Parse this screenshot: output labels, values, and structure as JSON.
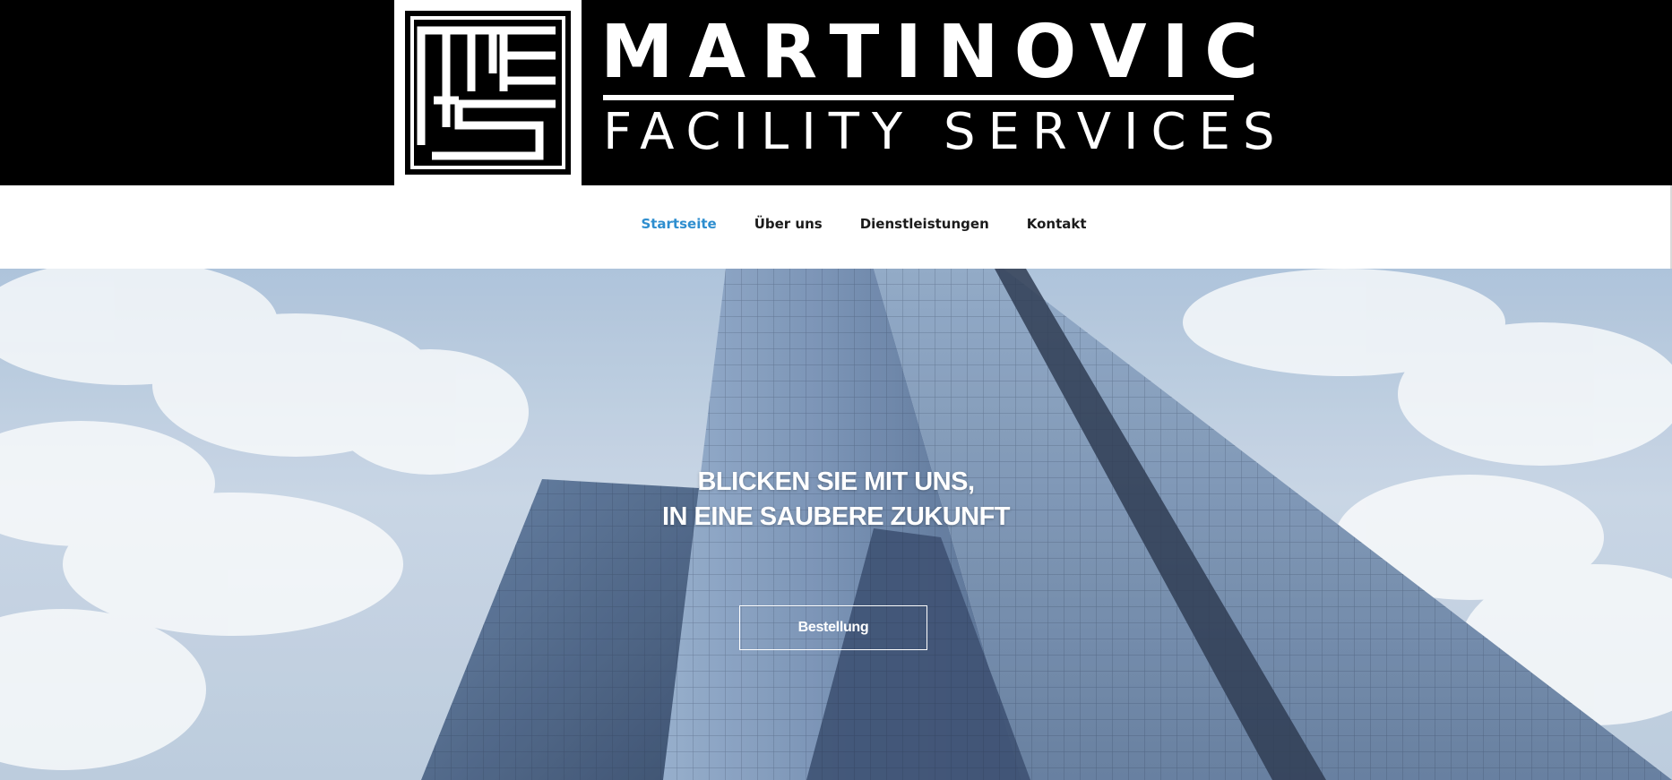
{
  "brand": {
    "name": "MARTINOVIC",
    "tagline": "FACILITY SERVICES",
    "monogram": "MFS",
    "colors": {
      "header_bg": "#000000",
      "logo_fg": "#ffffff"
    }
  },
  "nav": {
    "items": [
      {
        "label": "Startseite",
        "active": true
      },
      {
        "label": "Über uns",
        "active": false
      },
      {
        "label": "Dienstleistungen",
        "active": false
      },
      {
        "label": "Kontakt",
        "active": false
      }
    ],
    "active_color": "#2e8ecf",
    "text_color": "#1b1b1b"
  },
  "hero": {
    "heading_line1": "BLICKEN SIE MIT UNS,",
    "heading_line2": "IN EINE SAUBERE ZUKUNFT",
    "button_label": "Bestellung",
    "background": "sky-with-glass-skyscrapers"
  }
}
